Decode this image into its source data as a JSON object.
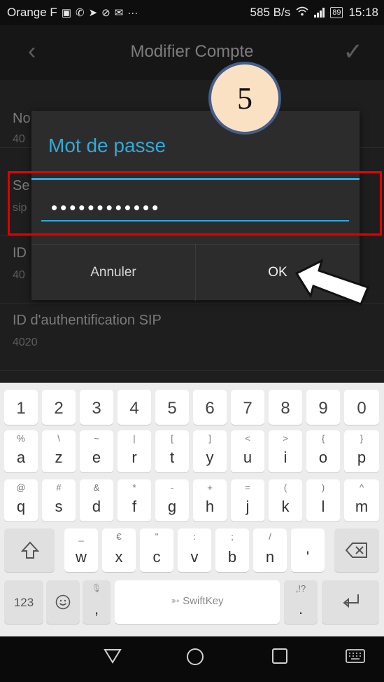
{
  "status_bar": {
    "carrier": "Orange F",
    "notification_icons": [
      "message-icon",
      "missed-call-icon",
      "maps-icon",
      "check-circle-icon",
      "mail-icon"
    ],
    "more": "···",
    "speed": "585 B/s",
    "battery": "89",
    "time": "15:18"
  },
  "app_bar": {
    "back_icon": "back-chevron-icon",
    "title": "Modifier Compte",
    "confirm_icon": "check-icon"
  },
  "settings": [
    {
      "label": "No",
      "value": "40"
    },
    {
      "label": "Se",
      "value": "sip"
    },
    {
      "label": "ID",
      "value": "40"
    },
    {
      "label": "ID d'authentification SIP",
      "value": "4020"
    }
  ],
  "dialog": {
    "title": "Mot de passe",
    "password_mask": "••••••••••••",
    "cancel": "Annuler",
    "ok": "OK"
  },
  "annotation": {
    "step": "5",
    "highlight_color": "#e00000",
    "badge_fill": "#fbe1c4",
    "badge_border": "#455e8a"
  },
  "keyboard": {
    "numbers": [
      "1",
      "2",
      "3",
      "4",
      "5",
      "6",
      "7",
      "8",
      "9",
      "0"
    ],
    "row1": [
      {
        "main": "a",
        "sub": "%"
      },
      {
        "main": "z",
        "sub": "\\"
      },
      {
        "main": "e",
        "sub": "~"
      },
      {
        "main": "r",
        "sub": "|"
      },
      {
        "main": "t",
        "sub": "["
      },
      {
        "main": "y",
        "sub": "]"
      },
      {
        "main": "u",
        "sub": "<"
      },
      {
        "main": "i",
        "sub": ">"
      },
      {
        "main": "o",
        "sub": "{"
      },
      {
        "main": "p",
        "sub": "}"
      }
    ],
    "row2": [
      {
        "main": "q",
        "sub": "@"
      },
      {
        "main": "s",
        "sub": "#"
      },
      {
        "main": "d",
        "sub": "&"
      },
      {
        "main": "f",
        "sub": "*"
      },
      {
        "main": "g",
        "sub": "-"
      },
      {
        "main": "h",
        "sub": "+"
      },
      {
        "main": "j",
        "sub": "="
      },
      {
        "main": "k",
        "sub": "("
      },
      {
        "main": "l",
        "sub": ")"
      },
      {
        "main": "m",
        "sub": "^"
      }
    ],
    "row3": [
      {
        "main": "w",
        "sub": "_"
      },
      {
        "main": "x",
        "sub": "€"
      },
      {
        "main": "c",
        "sub": "\""
      },
      {
        "main": "v",
        "sub": ":"
      },
      {
        "main": "b",
        "sub": ";"
      },
      {
        "main": "n",
        "sub": "/"
      },
      {
        "main": "'",
        "sub": ""
      }
    ],
    "bottom": {
      "numbers_key": "123",
      "emoji_icon": "smiley-icon",
      "comma": ",",
      "comma_sub": "mic",
      "space_brand": "SwiftKey",
      "period": ".",
      "period_sub": ",!?",
      "enter_icon": "enter-icon"
    },
    "shift_icon": "shift-icon",
    "backspace_icon": "backspace-icon"
  },
  "nav_bar": {
    "back": "back-triangle-icon",
    "home": "home-circle-icon",
    "recents": "recents-square-icon",
    "keyboard": "keyboard-icon"
  },
  "colors": {
    "accent": "#33a8d9",
    "dialog_bg": "#2c2c2c",
    "keyboard_bg": "#ececec"
  }
}
